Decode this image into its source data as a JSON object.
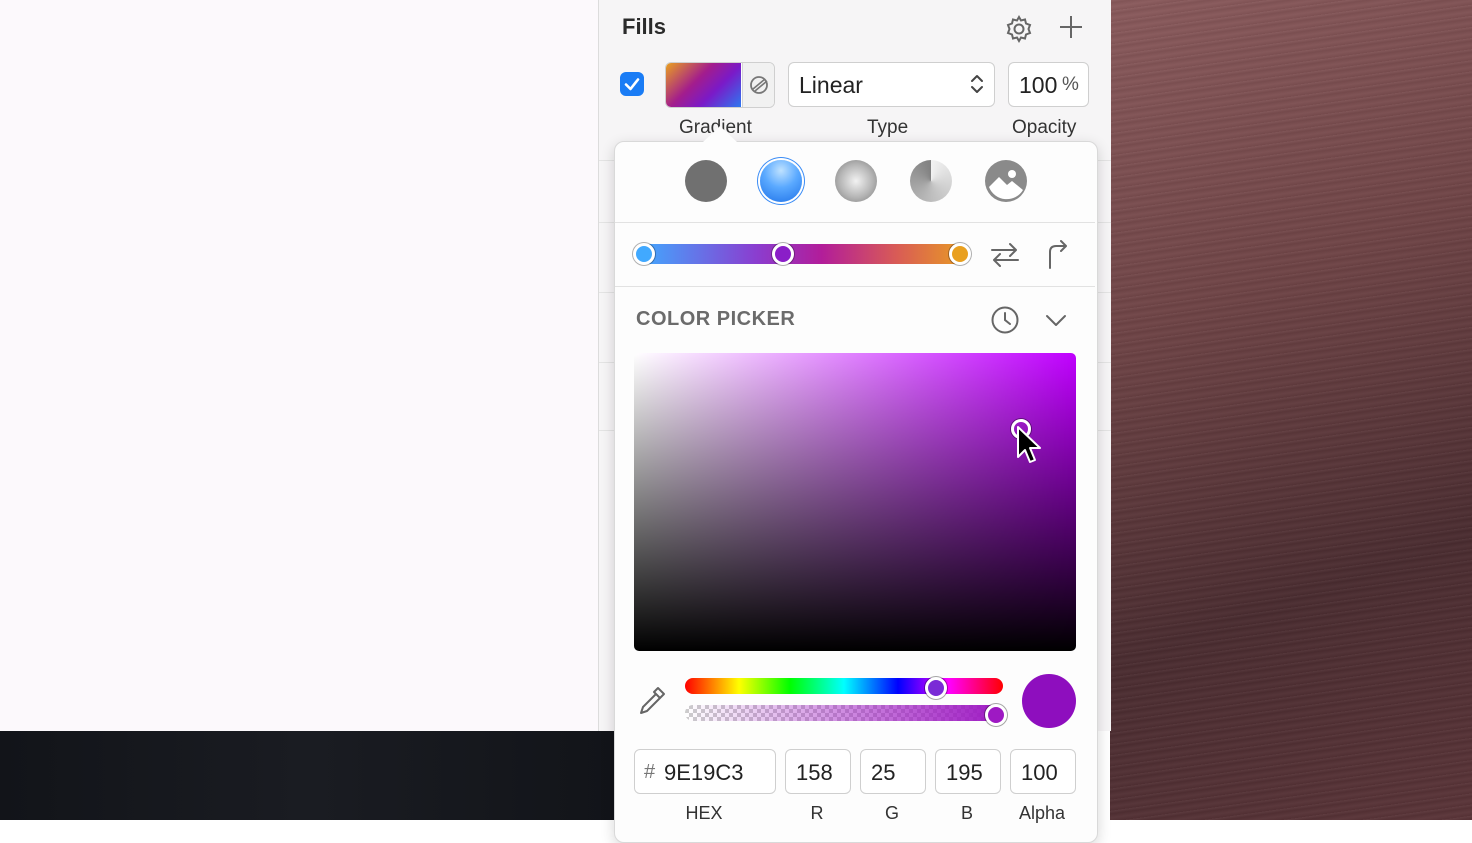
{
  "fills_panel": {
    "title": "Fills",
    "enabled": true,
    "fill_label": "Gradient",
    "type_value": "Linear",
    "type_label": "Type",
    "opacity_value": "100",
    "opacity_unit": "%",
    "opacity_label": "Opacity"
  },
  "popover": {
    "fill_modes": [
      "solid-fill",
      "linear-gradient",
      "radial-gradient",
      "angular-gradient",
      "image-fill"
    ],
    "selected_mode": "linear-gradient",
    "gradient_stops": [
      "#41a9ff",
      "#8a1ec8",
      "#e9a020"
    ],
    "color_picker": {
      "title": "COLOR PICKER",
      "hex_prefix": "#",
      "hex": "9E19C3",
      "r": "158",
      "g": "25",
      "b": "195",
      "alpha": "100",
      "labels": {
        "hex": "HEX",
        "r": "R",
        "g": "G",
        "b": "B",
        "alpha": "Alpha"
      },
      "preview_color": "#9E19C3"
    }
  },
  "colors": {
    "accent": "#1a7cf5",
    "desktop": "#6f4446"
  }
}
